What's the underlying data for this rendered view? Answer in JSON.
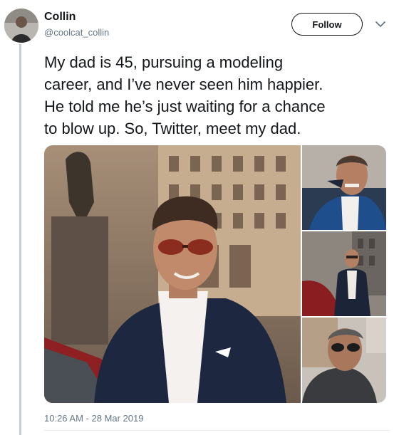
{
  "author": {
    "display_name": "Collin",
    "handle": "@coolcat_collin",
    "avatar_icon": "profile-avatar"
  },
  "actions": {
    "follow_label": "Follow",
    "more_icon": "chevron-down-icon"
  },
  "tweet": {
    "lines": [
      "My dad is 45, pursuing a modeling",
      "career, and I’ve never seen him happier.",
      "He told me he’s just waiting for a chance",
      "to blow up. So, Twitter, meet my dad."
    ],
    "timestamp": "10:26 AM - 28 Mar 2019"
  },
  "media": {
    "count": 4,
    "photos": [
      "man-in-sunglasses-navy-blazer-photo",
      "man-laughing-with-sunglasses-photo",
      "man-standing-by-red-car-photo",
      "man-in-sunglasses-hoodie-photo"
    ]
  },
  "colors": {
    "text": "#14171a",
    "secondary": "#657786",
    "thread_line": "#c4cfd6",
    "divider": "#e6ecf0"
  }
}
